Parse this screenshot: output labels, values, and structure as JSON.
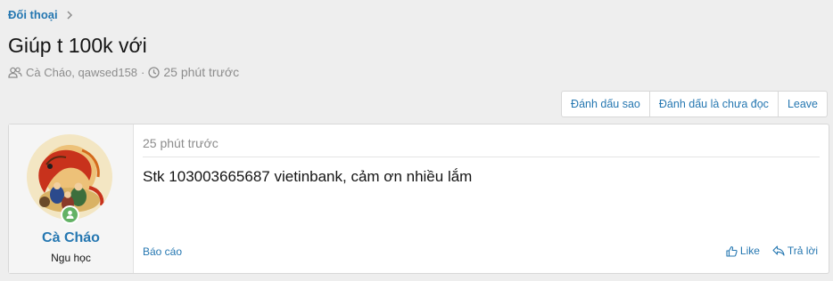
{
  "breadcrumb": {
    "label": "Đối thoại"
  },
  "thread": {
    "title": "Giúp t 100k với",
    "participants": "Cà Cháo, qawsed158",
    "separator": "·",
    "time": "25 phút trước"
  },
  "buttons": {
    "star": "Đánh dấu sao",
    "mark_unread": "Đánh dấu là chưa đọc",
    "leave": "Leave"
  },
  "message": {
    "user": {
      "name": "Cà Cháo",
      "title": "Ngu học",
      "online": true
    },
    "time": "25 phút trước",
    "body": "Stk 103003665687 vietinbank, cảm ơn nhiều lắm",
    "report": "Báo cáo",
    "like": "Like",
    "reply": "Trả lời"
  },
  "colors": {
    "link": "#2577b1",
    "muted": "#8c8c8c",
    "online": "#63b265",
    "page_bg": "#eeeeee"
  }
}
